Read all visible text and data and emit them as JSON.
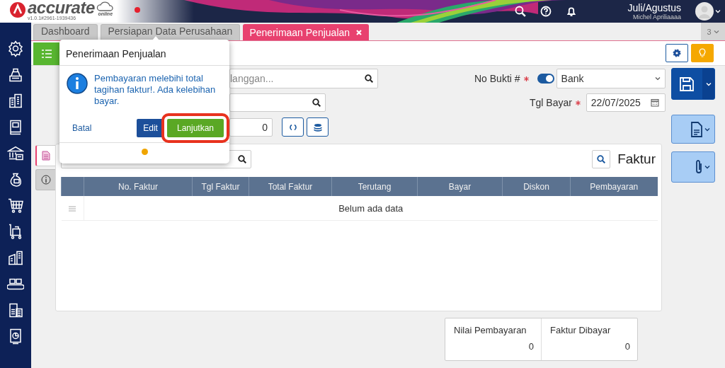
{
  "header": {
    "logo": "accurate",
    "logo_sub": "online",
    "version": "v1.0.1#2961-1939436",
    "period": "Juli/Agustus",
    "user": "Michel Apriliaaaa",
    "notification_dot": true
  },
  "tabs": [
    {
      "label": "Dashboard",
      "selected": false,
      "closable": false
    },
    {
      "label": "Persiapan Data Perusahaan",
      "selected": false,
      "closable": false
    },
    {
      "label": "Penerimaan Penjualan",
      "selected": true,
      "closable": true
    }
  ],
  "tab_count": "3",
  "form": {
    "customer": {
      "placeholder": "langgan..."
    },
    "no_bukti": {
      "label": "No Bukti #",
      "required": true,
      "toggle_on": true,
      "value": "Bank"
    },
    "tgl_bayar": {
      "label": "Tgl Bayar",
      "required": true,
      "value": "22/07/2025"
    },
    "amount": {
      "value": "0"
    }
  },
  "side_tabs": [
    {
      "kind": "document",
      "selected": true
    },
    {
      "kind": "info",
      "selected": false
    }
  ],
  "panel": {
    "title": "Faktur",
    "columns": [
      "No. Faktur",
      "Tgl Faktur",
      "Total Faktur",
      "Terutang",
      "Bayar",
      "Diskon",
      "Pembayaran"
    ],
    "empty_text": "Belum ada data"
  },
  "summary": [
    {
      "label": "Nilai Pembayaran",
      "value": "0"
    },
    {
      "label": "Faktur Dibayar",
      "value": "0"
    }
  ],
  "dialog": {
    "title": "Penerimaan Penjualan",
    "message": "Pembayaran melebihi total tagihan faktur!. Ada kelebihan bayar.",
    "buttons": [
      {
        "label": "Batal",
        "kind": "link",
        "highlighted": false
      },
      {
        "label": "Edit",
        "kind": "primary",
        "highlighted": false
      },
      {
        "label": "Lanjutkan",
        "kind": "success",
        "highlighted": true
      }
    ]
  }
}
